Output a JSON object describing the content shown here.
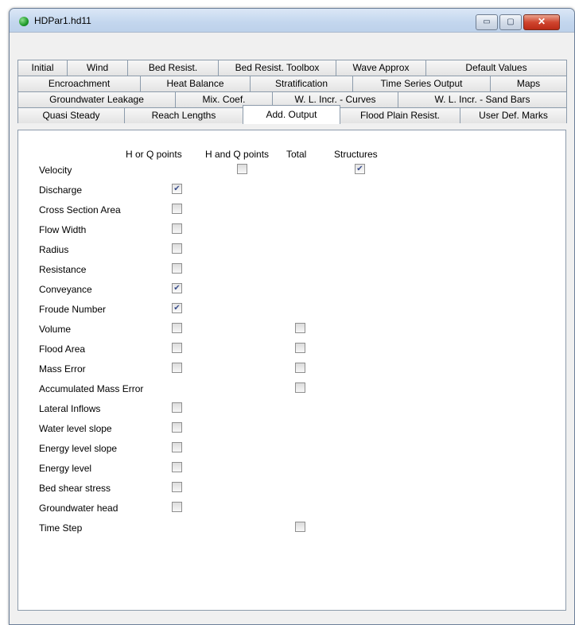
{
  "window": {
    "title": "HDPar1.hd11"
  },
  "caption_buttons": {
    "minimize": "▭",
    "maximize": "▢",
    "close": "✕"
  },
  "tabs": {
    "row1": [
      "Initial",
      "Wind",
      "Bed Resist.",
      "Bed Resist. Toolbox",
      "Wave Approx",
      "Default Values"
    ],
    "row2": [
      "Encroachment",
      "Heat Balance",
      "Stratification",
      "Time Series Output",
      "Maps"
    ],
    "row3": [
      "Groundwater Leakage",
      "Mix. Coef.",
      "W. L. Incr. - Curves",
      "W. L. Incr. - Sand Bars"
    ],
    "row4": [
      "Quasi Steady",
      "Reach Lengths",
      "Add. Output",
      "Flood Plain Resist.",
      "User Def. Marks"
    ],
    "selected": "Add. Output"
  },
  "columns": [
    "H or Q points",
    "H and Q points",
    "Total",
    "Structures"
  ],
  "rows": [
    {
      "label": "Velocity",
      "h_or_q": null,
      "h_and_q": false,
      "total": null,
      "structures": true
    },
    {
      "label": "Discharge",
      "h_or_q": true,
      "h_and_q": null,
      "total": null,
      "structures": null
    },
    {
      "label": "Cross Section Area",
      "h_or_q": false,
      "h_and_q": null,
      "total": null,
      "structures": null
    },
    {
      "label": "Flow Width",
      "h_or_q": false,
      "h_and_q": null,
      "total": null,
      "structures": null
    },
    {
      "label": "Radius",
      "h_or_q": false,
      "h_and_q": null,
      "total": null,
      "structures": null
    },
    {
      "label": "Resistance",
      "h_or_q": false,
      "h_and_q": null,
      "total": null,
      "structures": null
    },
    {
      "label": "Conveyance",
      "h_or_q": true,
      "h_and_q": null,
      "total": null,
      "structures": null
    },
    {
      "label": "Froude Number",
      "h_or_q": true,
      "h_and_q": null,
      "total": null,
      "structures": null
    },
    {
      "label": "Volume",
      "h_or_q": false,
      "h_and_q": null,
      "total": false,
      "structures": null
    },
    {
      "label": "Flood Area",
      "h_or_q": false,
      "h_and_q": null,
      "total": false,
      "structures": null
    },
    {
      "label": "Mass Error",
      "h_or_q": false,
      "h_and_q": null,
      "total": false,
      "structures": null
    },
    {
      "label": "Accumulated Mass Error",
      "h_or_q": null,
      "h_and_q": null,
      "total": false,
      "structures": null
    },
    {
      "label": "Lateral Inflows",
      "h_or_q": false,
      "h_and_q": null,
      "total": null,
      "structures": null
    },
    {
      "label": "Water level slope",
      "h_or_q": false,
      "h_and_q": null,
      "total": null,
      "structures": null
    },
    {
      "label": "Energy level slope",
      "h_or_q": false,
      "h_and_q": null,
      "total": null,
      "structures": null
    },
    {
      "label": "Energy level",
      "h_or_q": false,
      "h_and_q": null,
      "total": null,
      "structures": null
    },
    {
      "label": "Bed shear stress",
      "h_or_q": false,
      "h_and_q": null,
      "total": null,
      "structures": null
    },
    {
      "label": "Groundwater head",
      "h_or_q": false,
      "h_and_q": null,
      "total": null,
      "structures": null
    },
    {
      "label": "Time Step",
      "h_or_q": null,
      "h_and_q": null,
      "total": false,
      "structures": null
    }
  ],
  "colors": {
    "app_icon": "#1f9a2b",
    "close_button": "#d0452f",
    "check_mark": "#3c4f8c"
  }
}
